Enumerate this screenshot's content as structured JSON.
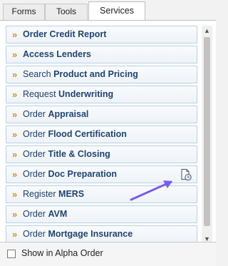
{
  "tabs": [
    {
      "label": "Forms"
    },
    {
      "label": "Tools"
    },
    {
      "label": "Services",
      "active": true
    }
  ],
  "services": [
    {
      "prefix": "",
      "main": "Order Credit Report"
    },
    {
      "prefix": "",
      "main": "Access Lenders"
    },
    {
      "prefix": "Search ",
      "main": "Product and Pricing"
    },
    {
      "prefix": "Request ",
      "main": "Underwriting"
    },
    {
      "prefix": "Order ",
      "main": "Appraisal"
    },
    {
      "prefix": "Order ",
      "main": "Flood Certification"
    },
    {
      "prefix": "Order ",
      "main": "Title & Closing"
    },
    {
      "prefix": "Order ",
      "main": "Doc Preparation",
      "icon": "document-clock-icon"
    },
    {
      "prefix": "Register ",
      "main": "MERS"
    },
    {
      "prefix": "Order ",
      "main": "AVM"
    },
    {
      "prefix": "Order ",
      "main": "Mortgage Insurance"
    }
  ],
  "footer": {
    "checkbox_label": "Show in Alpha Order",
    "checked": false
  },
  "colors": {
    "bullet": "#d9901a",
    "item_text": "#1f4472",
    "item_border": "#b9d0e6",
    "arrow": "#7b5cf0"
  }
}
